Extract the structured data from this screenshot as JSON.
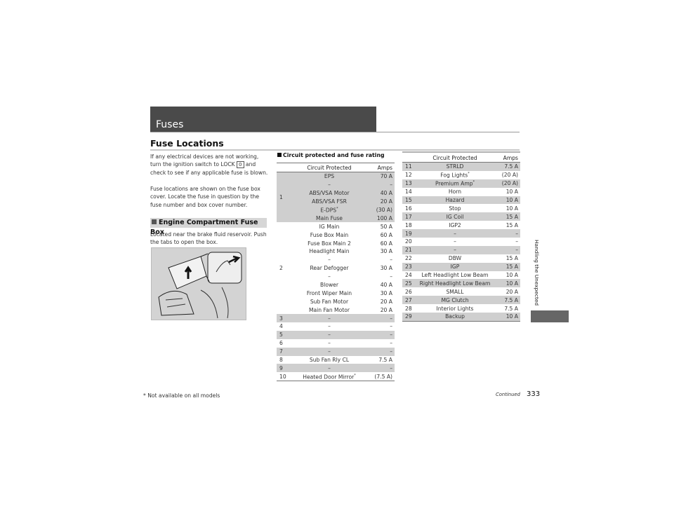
{
  "header": {
    "title": "Fuses"
  },
  "section_title": "Fuse Locations",
  "intro": {
    "paragraph1_before": "If any electrical devices are not working, turn the ignition switch to LOCK ",
    "lock_key": "0",
    "paragraph1_after": " and check to see if any applicable fuse is blown.",
    "paragraph2": "Fuse locations are shown on the fuse box cover. Locate the fuse in question by the fuse number and box cover number."
  },
  "engine_box": {
    "heading": "Engine Compartment Fuse Box",
    "description": "Located near the brake fluid reservoir. Push the tabs to open the box.",
    "figure": "fuse-box-illustration"
  },
  "rating_section": {
    "title": "Circuit protected and fuse rating"
  },
  "table_headers": {
    "circuit": "Circuit Protected",
    "amps": "Amps"
  },
  "table1": {
    "group1": {
      "num": "1",
      "rows": [
        {
          "circuit": "EPS",
          "amps": "70 A"
        },
        {
          "circuit": "–",
          "amps": "–"
        },
        {
          "circuit": "ABS/VSA Motor",
          "amps": "40 A"
        },
        {
          "circuit": "ABS/VSA FSR",
          "amps": "20 A"
        },
        {
          "circuit": "E-DPS",
          "sup": "*",
          "amps": "(30 A)"
        },
        {
          "circuit": "Main Fuse",
          "amps": "100 A"
        }
      ]
    },
    "group2": {
      "num": "2",
      "rows": [
        {
          "circuit": "IG Main",
          "amps": "50 A"
        },
        {
          "circuit": "Fuse Box Main",
          "amps": "60 A"
        },
        {
          "circuit": "Fuse Box Main 2",
          "amps": "60 A"
        },
        {
          "circuit": "Headlight Main",
          "amps": "30 A"
        },
        {
          "circuit": "–",
          "amps": "–"
        },
        {
          "circuit": "Rear Defogger",
          "amps": "30 A"
        },
        {
          "circuit": "–",
          "amps": "–"
        },
        {
          "circuit": "Blower",
          "amps": "40 A"
        },
        {
          "circuit": "Front Wiper Main",
          "amps": "30 A"
        },
        {
          "circuit": "Sub Fan Motor",
          "amps": "20 A"
        },
        {
          "circuit": "Main Fan Motor",
          "amps": "20 A"
        }
      ]
    },
    "rows": [
      {
        "num": "3",
        "circuit": "–",
        "amps": "–"
      },
      {
        "num": "4",
        "circuit": "–",
        "amps": "–"
      },
      {
        "num": "5",
        "circuit": "–",
        "amps": "–"
      },
      {
        "num": "6",
        "circuit": "–",
        "amps": "–"
      },
      {
        "num": "7",
        "circuit": "–",
        "amps": "–"
      },
      {
        "num": "8",
        "circuit": "Sub Fan Rly CL",
        "amps": "7.5 A"
      },
      {
        "num": "9",
        "circuit": "–",
        "amps": "–"
      },
      {
        "num": "10",
        "circuit": "Heated Door Mirror",
        "sup": "*",
        "amps": "(7.5 A)"
      }
    ]
  },
  "table2": {
    "rows": [
      {
        "num": "11",
        "circuit": "STRLD",
        "amps": "7.5 A"
      },
      {
        "num": "12",
        "circuit": "Fog Lights",
        "sup": "*",
        "amps": "(20 A)"
      },
      {
        "num": "13",
        "circuit": "Premium Amp",
        "sup": "*",
        "amps": "(20 A)"
      },
      {
        "num": "14",
        "circuit": "Horn",
        "amps": "10 A"
      },
      {
        "num": "15",
        "circuit": "Hazard",
        "amps": "10 A"
      },
      {
        "num": "16",
        "circuit": "Stop",
        "amps": "10 A"
      },
      {
        "num": "17",
        "circuit": "IG Coil",
        "amps": "15 A"
      },
      {
        "num": "18",
        "circuit": "IGP2",
        "amps": "15 A"
      },
      {
        "num": "19",
        "circuit": "–",
        "amps": "–"
      },
      {
        "num": "20",
        "circuit": "–",
        "amps": "–"
      },
      {
        "num": "21",
        "circuit": "–",
        "amps": "–"
      },
      {
        "num": "22",
        "circuit": "DBW",
        "amps": "15 A"
      },
      {
        "num": "23",
        "circuit": "IGP",
        "amps": "15 A"
      },
      {
        "num": "24",
        "circuit": "Left Headlight Low Beam",
        "amps": "10 A"
      },
      {
        "num": "25",
        "circuit": "Right Headlight Low Beam",
        "amps": "10 A"
      },
      {
        "num": "26",
        "circuit": "SMALL",
        "amps": "20 A"
      },
      {
        "num": "27",
        "circuit": "MG Clutch",
        "amps": "7.5 A"
      },
      {
        "num": "28",
        "circuit": "Interior Lights",
        "amps": "7.5 A"
      },
      {
        "num": "29",
        "circuit": "Backup",
        "amps": "10 A"
      }
    ]
  },
  "side_tab": {
    "label": "Handling the Unexpected"
  },
  "footer": {
    "footnote": "* Not available on all models",
    "continued": "Continued",
    "page_number": "333"
  },
  "colors": {
    "header_band": "#4a4a4a",
    "row_shade": "#cfcfcf",
    "side_tab": "#666666"
  }
}
